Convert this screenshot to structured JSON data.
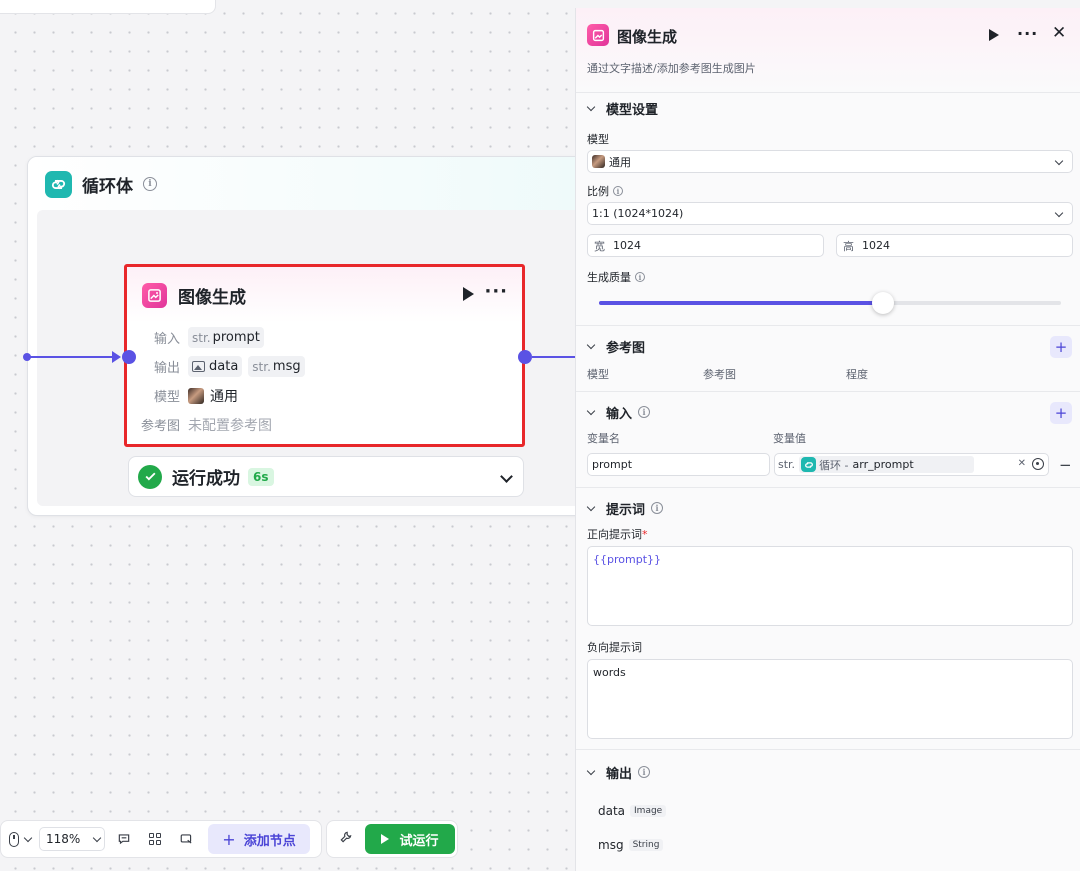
{
  "canvas": {
    "loop": {
      "title": "循环体"
    },
    "node": {
      "title": "图像生成",
      "input_label": "输入",
      "input_tag_prefix": "str.",
      "input_tag": "prompt",
      "output_label": "输出",
      "output_tag1": "data",
      "output_tag2_prefix": "str.",
      "output_tag2": "msg",
      "model_label": "模型",
      "model_value": "通用",
      "ref_label": "参考图",
      "ref_value": "未配置参考图"
    },
    "status": {
      "text": "运行成功",
      "badge": "6s"
    }
  },
  "toolbar": {
    "zoom": "118%",
    "add_node": "添加节点",
    "try_run": "试运行"
  },
  "panel": {
    "title": "图像生成",
    "description": "通过文字描述/添加参考图生成图片",
    "model_section": {
      "title": "模型设置",
      "model_label": "模型",
      "model_value": "通用",
      "ratio_label": "比例",
      "ratio_value": "1:1 (1024*1024)",
      "width_key": "宽",
      "width_value": "1024",
      "height_key": "高",
      "height_value": "1024",
      "quality_label": "生成质量",
      "quality_level": 0.615
    },
    "ref_section": {
      "title": "参考图",
      "col_model": "模型",
      "col_ref": "参考图",
      "col_degree": "程度"
    },
    "input_section": {
      "title": "输入",
      "col_name": "变量名",
      "col_value": "变量值",
      "var_name": "prompt",
      "var_prefix": "str.",
      "var_source": "循环 -",
      "var_value": "arr_prompt"
    },
    "prompt_section": {
      "title": "提示词",
      "positive_label": "正向提示词",
      "required_mark": "*",
      "positive_value": "{{prompt}}",
      "negative_label": "负向提示词",
      "negative_value": "words"
    },
    "output_section": {
      "title": "输出",
      "items": [
        {
          "name": "data",
          "type": "Image"
        },
        {
          "name": "msg",
          "type": "String"
        }
      ]
    }
  }
}
